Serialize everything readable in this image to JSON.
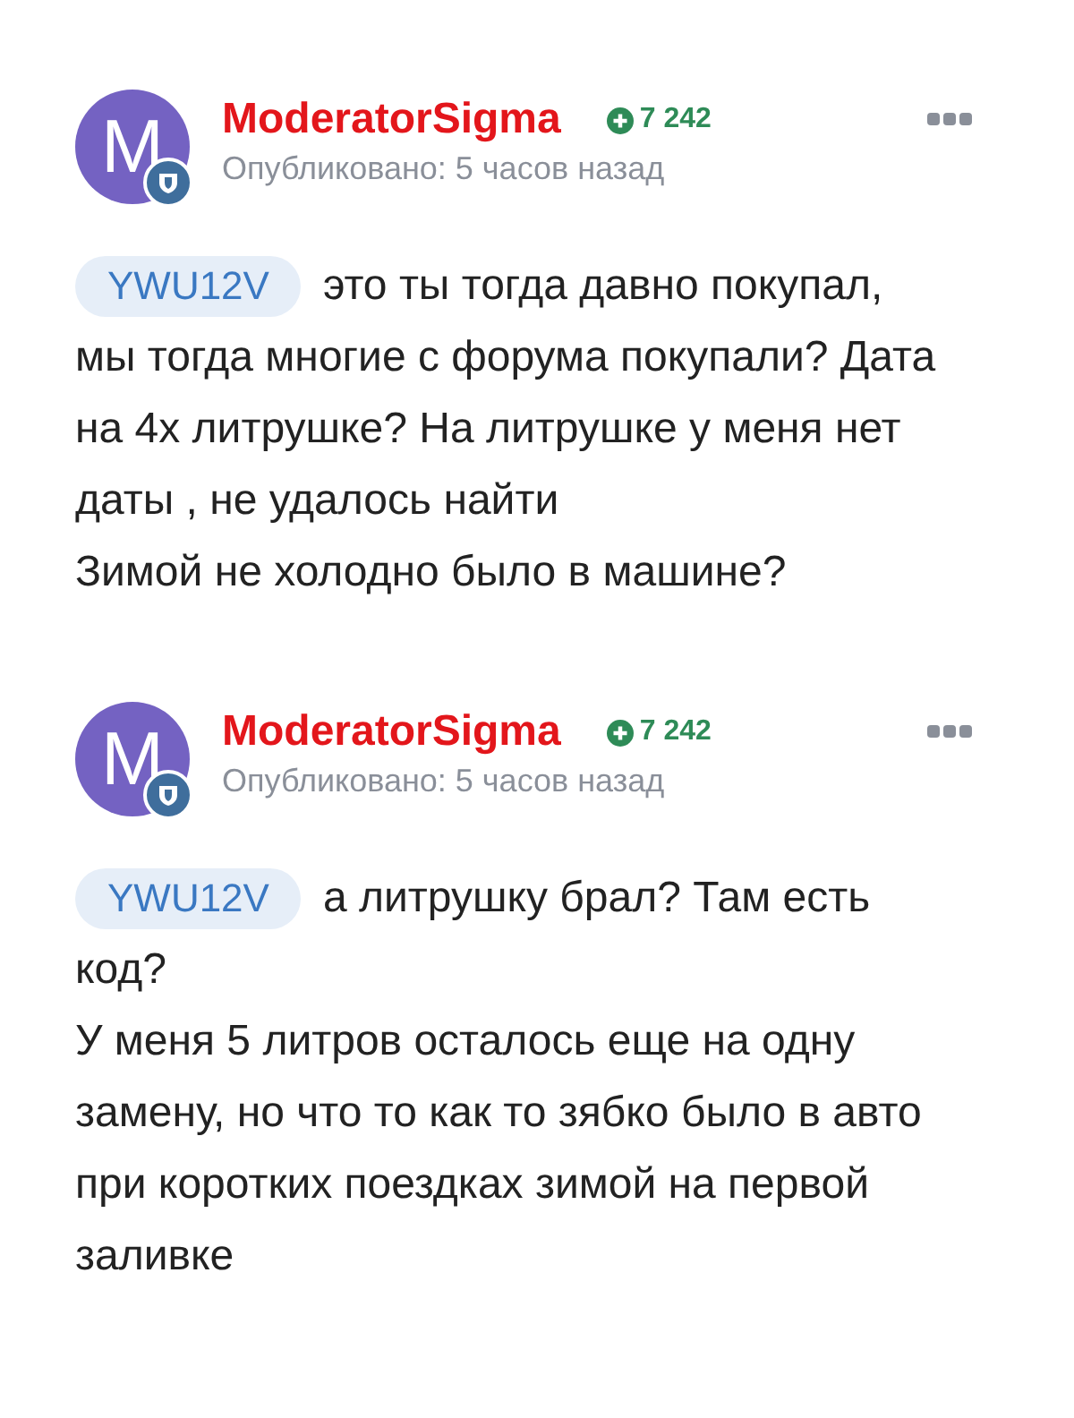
{
  "posts": [
    {
      "avatar_letter": "M",
      "author": "ModeratorSigma",
      "reputation": "7 242",
      "published": "Опубликовано: 5 часов назад",
      "mention": "YWU12V",
      "first_line": "это ты тогда давно покупал,",
      "paragraphs": [
        "мы тогда многие с форума покупали? Дата на 4х литрушке? На литрушке у меня нет даты , не удалось найти",
        "Зимой не холодно было в машине?"
      ]
    },
    {
      "avatar_letter": "M",
      "author": "ModeratorSigma",
      "reputation": "7 242",
      "published": "Опубликовано: 5 часов назад",
      "mention": "YWU12V",
      "first_line": "а литрушку брал? Там есть",
      "paragraphs": [
        "код?",
        "У меня 5 литров осталось еще на одну замену, но что то как то зябко было в авто при коротких поездках зимой на первой заливке"
      ]
    }
  ]
}
